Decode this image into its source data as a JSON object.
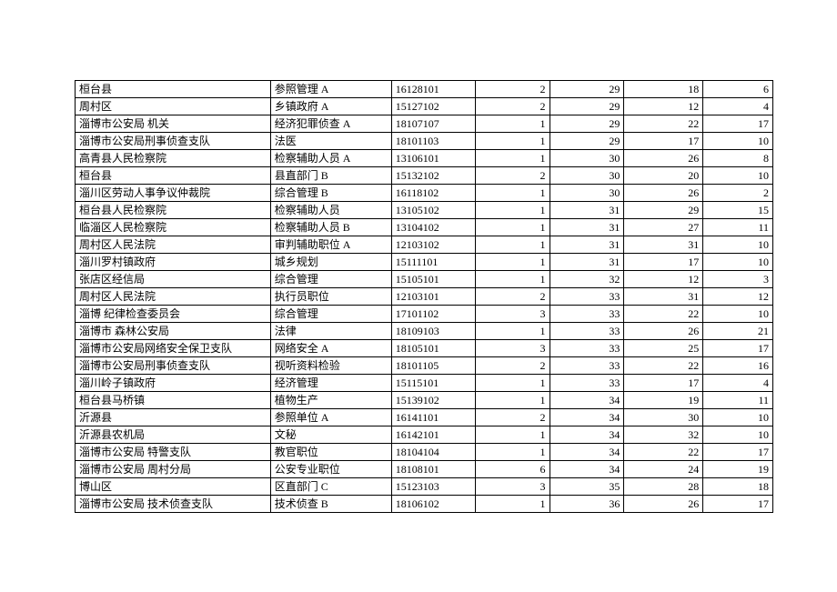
{
  "rows": [
    {
      "org": "桓台县",
      "pos": "参照管理 A",
      "code": "16128101",
      "n1": 2,
      "n2": 29,
      "n3": 18,
      "n4": 6
    },
    {
      "org": "周村区",
      "pos": "乡镇政府 A",
      "code": "15127102",
      "n1": 2,
      "n2": 29,
      "n3": 12,
      "n4": 4
    },
    {
      "org": "淄博市公安局 机关",
      "pos": "经济犯罪侦查 A",
      "code": "18107107",
      "n1": 1,
      "n2": 29,
      "n3": 22,
      "n4": 17
    },
    {
      "org": "淄博市公安局刑事侦查支队",
      "pos": "法医",
      "code": "18101103",
      "n1": 1,
      "n2": 29,
      "n3": 17,
      "n4": 10
    },
    {
      "org": "高青县人民检察院",
      "pos": "检察辅助人员 A",
      "code": "13106101",
      "n1": 1,
      "n2": 30,
      "n3": 26,
      "n4": 8
    },
    {
      "org": "桓台县",
      "pos": "县直部门 B",
      "code": "15132102",
      "n1": 2,
      "n2": 30,
      "n3": 20,
      "n4": 10
    },
    {
      "org": "淄川区劳动人事争议仲裁院",
      "pos": "综合管理 B",
      "code": "16118102",
      "n1": 1,
      "n2": 30,
      "n3": 26,
      "n4": 2
    },
    {
      "org": "桓台县人民检察院",
      "pos": "检察辅助人员",
      "code": "13105102",
      "n1": 1,
      "n2": 31,
      "n3": 29,
      "n4": 15
    },
    {
      "org": "临淄区人民检察院",
      "pos": "检察辅助人员 B",
      "code": "13104102",
      "n1": 1,
      "n2": 31,
      "n3": 27,
      "n4": 11
    },
    {
      "org": "周村区人民法院",
      "pos": "审判辅助职位 A",
      "code": "12103102",
      "n1": 1,
      "n2": 31,
      "n3": 31,
      "n4": 10
    },
    {
      "org": "淄川罗村镇政府",
      "pos": "城乡规划",
      "code": "15111101",
      "n1": 1,
      "n2": 31,
      "n3": 17,
      "n4": 10
    },
    {
      "org": "张店区经信局",
      "pos": "综合管理",
      "code": "15105101",
      "n1": 1,
      "n2": 32,
      "n3": 12,
      "n4": 3
    },
    {
      "org": "周村区人民法院",
      "pos": "执行员职位",
      "code": "12103101",
      "n1": 2,
      "n2": 33,
      "n3": 31,
      "n4": 12
    },
    {
      "org": "淄博 纪律检查委员会",
      "pos": "综合管理",
      "code": "17101102",
      "n1": 3,
      "n2": 33,
      "n3": 22,
      "n4": 10
    },
    {
      "org": "淄博市 森林公安局",
      "pos": "法律",
      "code": "18109103",
      "n1": 1,
      "n2": 33,
      "n3": 26,
      "n4": 21
    },
    {
      "org": "淄博市公安局网络安全保卫支队",
      "pos": "网络安全 A",
      "code": "18105101",
      "n1": 3,
      "n2": 33,
      "n3": 25,
      "n4": 17
    },
    {
      "org": "淄博市公安局刑事侦查支队",
      "pos": "视听资料检验",
      "code": "18101105",
      "n1": 2,
      "n2": 33,
      "n3": 22,
      "n4": 16
    },
    {
      "org": "淄川岭子镇政府",
      "pos": "经济管理",
      "code": "15115101",
      "n1": 1,
      "n2": 33,
      "n3": 17,
      "n4": 4
    },
    {
      "org": "桓台县马桥镇",
      "pos": "植物生产",
      "code": "15139102",
      "n1": 1,
      "n2": 34,
      "n3": 19,
      "n4": 11
    },
    {
      "org": "沂源县",
      "pos": "参照单位 A",
      "code": "16141101",
      "n1": 2,
      "n2": 34,
      "n3": 30,
      "n4": 10
    },
    {
      "org": "沂源县农机局",
      "pos": "文秘",
      "code": "16142101",
      "n1": 1,
      "n2": 34,
      "n3": 32,
      "n4": 10
    },
    {
      "org": "淄博市公安局 特警支队",
      "pos": "教官职位",
      "code": "18104104",
      "n1": 1,
      "n2": 34,
      "n3": 22,
      "n4": 17
    },
    {
      "org": "淄博市公安局 周村分局",
      "pos": "公安专业职位",
      "code": "18108101",
      "n1": 6,
      "n2": 34,
      "n3": 24,
      "n4": 19
    },
    {
      "org": "博山区",
      "pos": "区直部门 C",
      "code": "15123103",
      "n1": 3,
      "n2": 35,
      "n3": 28,
      "n4": 18
    },
    {
      "org": "淄博市公安局 技术侦查支队",
      "pos": "技术侦查 B",
      "code": "18106102",
      "n1": 1,
      "n2": 36,
      "n3": 26,
      "n4": 17
    }
  ]
}
